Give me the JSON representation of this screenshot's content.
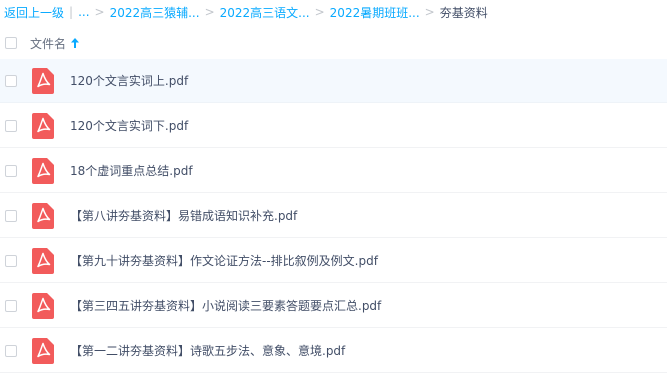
{
  "breadcrumb": {
    "back": "返回上一级",
    "divider": "|",
    "ellipsis": "...",
    "items": [
      "2022高三猿辅...",
      "2022高三语文...",
      "2022暑期班班..."
    ],
    "separator": ">",
    "current": "夯基资料"
  },
  "header": {
    "column_name": "文件名",
    "sort_direction": "ascending"
  },
  "files": [
    {
      "name": "120个文言实词上.pdf",
      "icon": "pdf-icon"
    },
    {
      "name": "120个文言实词下.pdf",
      "icon": "pdf-icon"
    },
    {
      "name": "18个虚词重点总结.pdf",
      "icon": "pdf-icon"
    },
    {
      "name": "【第八讲夯基资料】易错成语知识补充.pdf",
      "icon": "pdf-icon"
    },
    {
      "name": "【第九十讲夯基资料】作文论证方法--排比叙例及例文.pdf",
      "icon": "pdf-icon"
    },
    {
      "name": "【第三四五讲夯基资料】小说阅读三要素答题要点汇总.pdf",
      "icon": "pdf-icon"
    },
    {
      "name": "【第一二讲夯基资料】诗歌五步法、意象、意境.pdf",
      "icon": "pdf-icon"
    }
  ],
  "colors": {
    "link": "#09aaff",
    "pdf_icon": "#f25b5b",
    "selected_row": "#f4f9fe",
    "text": "#424e67"
  }
}
